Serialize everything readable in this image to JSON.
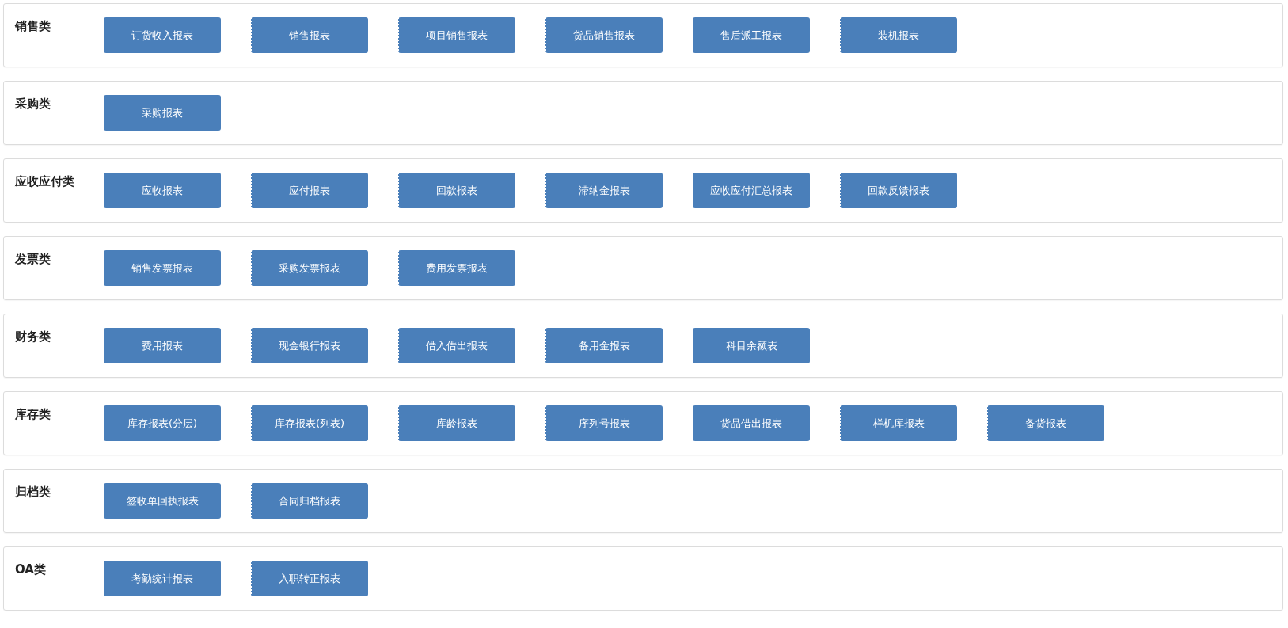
{
  "categories": [
    {
      "title": "销售类",
      "reports": [
        "订货收入报表",
        "销售报表",
        "项目销售报表",
        "货品销售报表",
        "售后派工报表",
        "装机报表"
      ]
    },
    {
      "title": "采购类",
      "reports": [
        "采购报表"
      ]
    },
    {
      "title": "应收应付类",
      "reports": [
        "应收报表",
        "应付报表",
        "回款报表",
        "滞纳金报表",
        "应收应付汇总报表",
        "回款反馈报表"
      ]
    },
    {
      "title": "发票类",
      "reports": [
        "销售发票报表",
        "采购发票报表",
        "费用发票报表"
      ]
    },
    {
      "title": "财务类",
      "reports": [
        "费用报表",
        "现金银行报表",
        "借入借出报表",
        "备用金报表",
        "科目余额表"
      ]
    },
    {
      "title": "库存类",
      "reports": [
        "库存报表(分层)",
        "库存报表(列表)",
        "库龄报表",
        "序列号报表",
        "货品借出报表",
        "样机库报表",
        "备货报表"
      ]
    },
    {
      "title": "归档类",
      "reports": [
        "签收单回执报表",
        "合同归档报表"
      ]
    },
    {
      "title": "OA类",
      "reports": [
        "考勤统计报表",
        "入职转正报表"
      ]
    }
  ]
}
